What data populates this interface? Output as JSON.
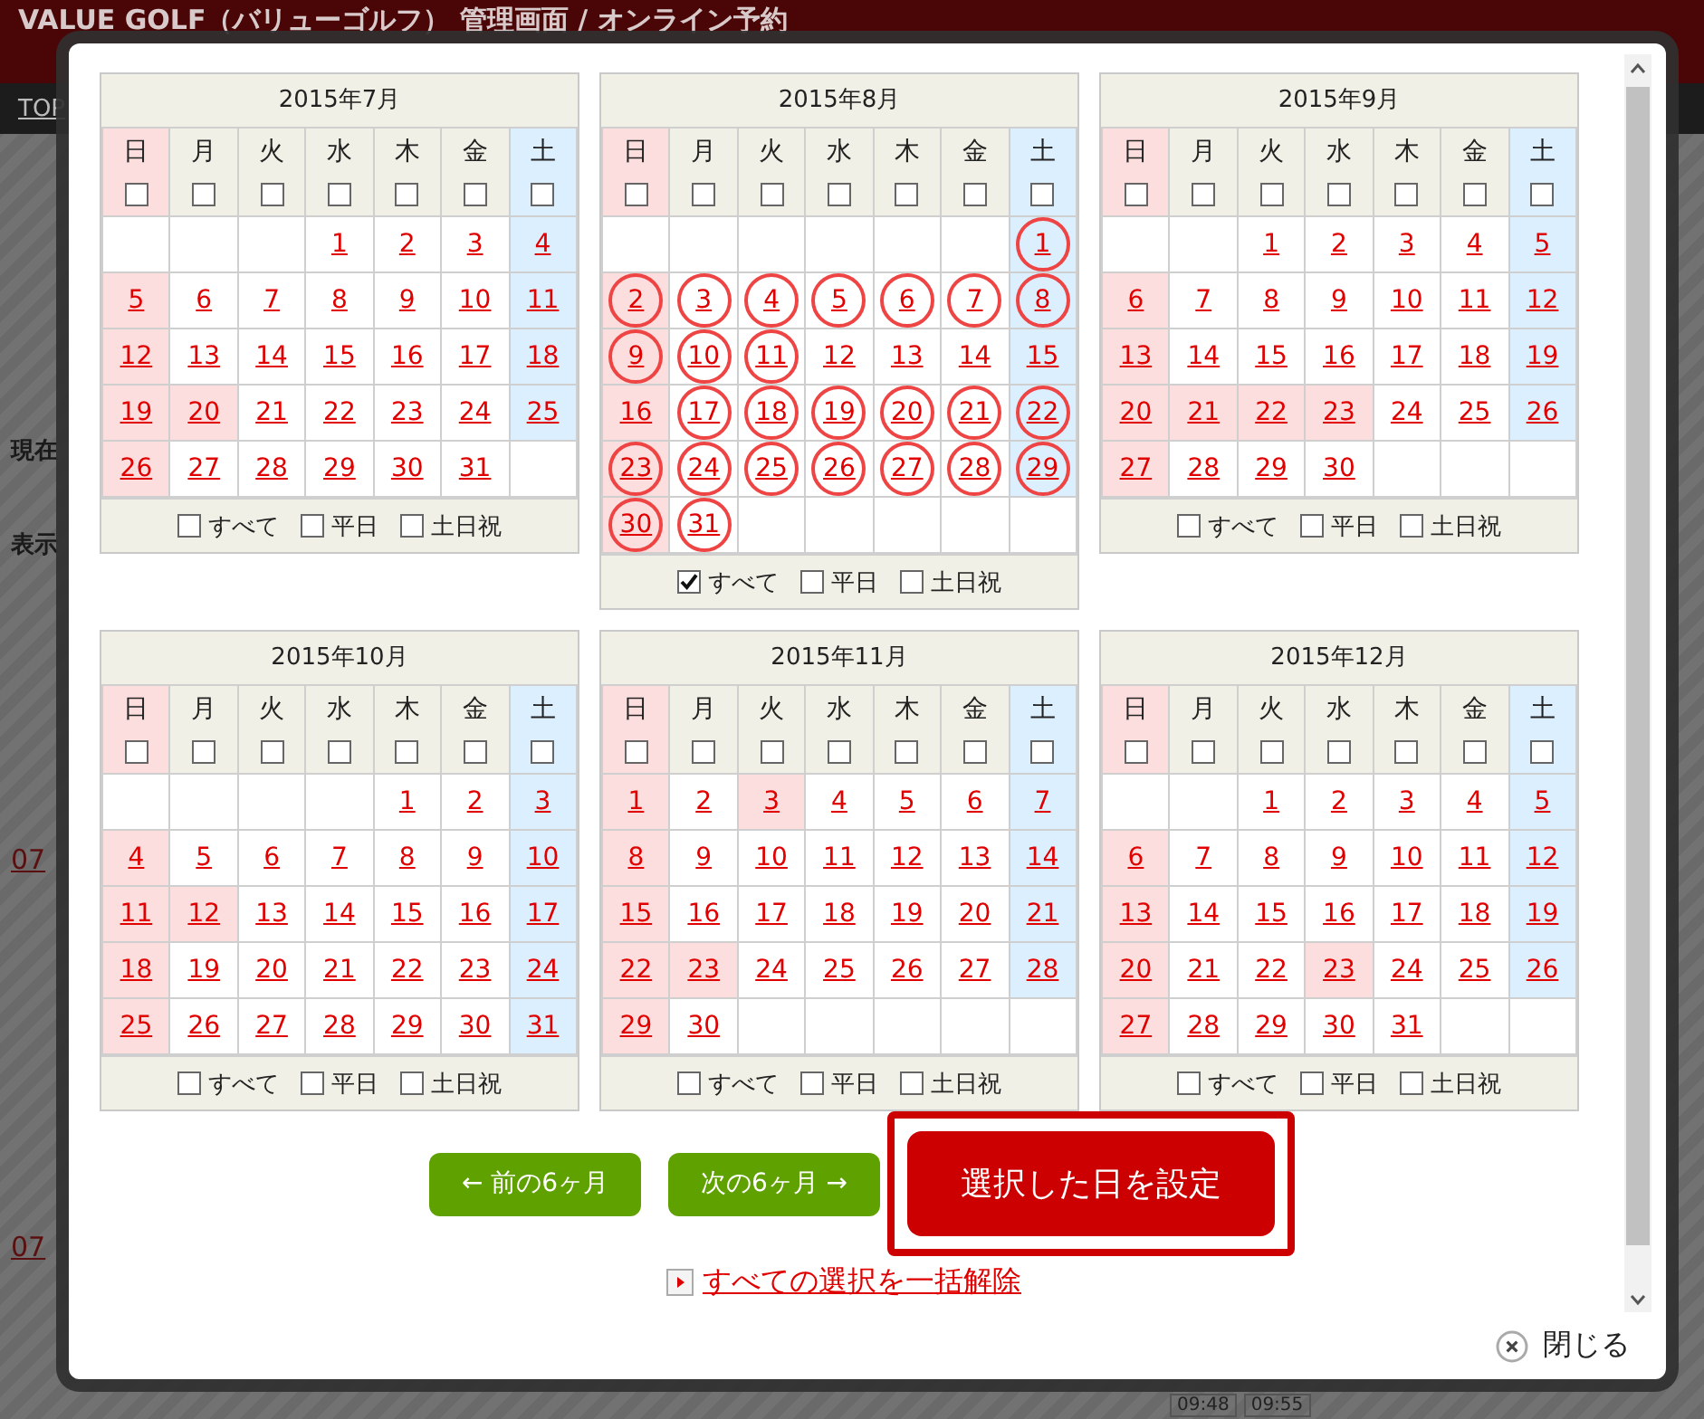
{
  "background": {
    "title": "VALUE GOLF（バリューゴルフ） 管理画面 / オンライン予約",
    "nav_link": "TOP",
    "left_labels": [
      "現在",
      "表示"
    ],
    "row_links": [
      "07",
      "07"
    ],
    "time_chips": [
      "09:48",
      "09:55"
    ]
  },
  "months": [
    {
      "title": "2015年7月",
      "weekdays": [
        {
          "label": "日",
          "checked": false
        },
        {
          "label": "月",
          "checked": false
        },
        {
          "label": "火",
          "checked": false
        },
        {
          "label": "水",
          "checked": false
        },
        {
          "label": "木",
          "checked": false
        },
        {
          "label": "金",
          "checked": false
        },
        {
          "label": "土",
          "checked": false
        }
      ],
      "weeks": [
        [
          {
            "kind": "blank"
          },
          {
            "kind": "blank"
          },
          {
            "kind": "blank"
          },
          {
            "day": "1",
            "kind": "weekday",
            "selected": false
          },
          {
            "day": "2",
            "kind": "weekday",
            "selected": false
          },
          {
            "day": "3",
            "kind": "weekday",
            "selected": false
          },
          {
            "day": "4",
            "kind": "sat",
            "selected": false
          }
        ],
        [
          {
            "day": "5",
            "kind": "sun",
            "selected": false
          },
          {
            "day": "6",
            "kind": "weekday",
            "selected": false
          },
          {
            "day": "7",
            "kind": "weekday",
            "selected": false
          },
          {
            "day": "8",
            "kind": "weekday",
            "selected": false
          },
          {
            "day": "9",
            "kind": "weekday",
            "selected": false
          },
          {
            "day": "10",
            "kind": "weekday",
            "selected": false
          },
          {
            "day": "11",
            "kind": "sat",
            "selected": false
          }
        ],
        [
          {
            "day": "12",
            "kind": "sun",
            "selected": false
          },
          {
            "day": "13",
            "kind": "weekday",
            "selected": false
          },
          {
            "day": "14",
            "kind": "weekday",
            "selected": false
          },
          {
            "day": "15",
            "kind": "weekday",
            "selected": false
          },
          {
            "day": "16",
            "kind": "weekday",
            "selected": false
          },
          {
            "day": "17",
            "kind": "weekday",
            "selected": false
          },
          {
            "day": "18",
            "kind": "sat",
            "selected": false
          }
        ],
        [
          {
            "day": "19",
            "kind": "sun",
            "selected": false
          },
          {
            "day": "20",
            "kind": "holiday",
            "selected": false
          },
          {
            "day": "21",
            "kind": "weekday",
            "selected": false
          },
          {
            "day": "22",
            "kind": "weekday",
            "selected": false
          },
          {
            "day": "23",
            "kind": "weekday",
            "selected": false
          },
          {
            "day": "24",
            "kind": "weekday",
            "selected": false
          },
          {
            "day": "25",
            "kind": "sat",
            "selected": false
          }
        ],
        [
          {
            "day": "26",
            "kind": "sun",
            "selected": false
          },
          {
            "day": "27",
            "kind": "weekday",
            "selected": false
          },
          {
            "day": "28",
            "kind": "weekday",
            "selected": false
          },
          {
            "day": "29",
            "kind": "weekday",
            "selected": false
          },
          {
            "day": "30",
            "kind": "weekday",
            "selected": false
          },
          {
            "day": "31",
            "kind": "weekday",
            "selected": false
          },
          {
            "kind": "blank"
          }
        ]
      ],
      "options": [
        {
          "label": "すべて",
          "checked": false
        },
        {
          "label": "平日",
          "checked": false
        },
        {
          "label": "土日祝",
          "checked": false
        }
      ]
    },
    {
      "title": "2015年8月",
      "weekdays": [
        {
          "label": "日",
          "checked": false
        },
        {
          "label": "月",
          "checked": false
        },
        {
          "label": "火",
          "checked": false
        },
        {
          "label": "水",
          "checked": false
        },
        {
          "label": "木",
          "checked": false
        },
        {
          "label": "金",
          "checked": false
        },
        {
          "label": "土",
          "checked": false
        }
      ],
      "weeks": [
        [
          {
            "kind": "blank"
          },
          {
            "kind": "blank"
          },
          {
            "kind": "blank"
          },
          {
            "kind": "blank"
          },
          {
            "kind": "blank"
          },
          {
            "kind": "blank"
          },
          {
            "day": "1",
            "kind": "sat",
            "selected": true
          }
        ],
        [
          {
            "day": "2",
            "kind": "sun",
            "selected": true
          },
          {
            "day": "3",
            "kind": "weekday",
            "selected": true
          },
          {
            "day": "4",
            "kind": "weekday",
            "selected": true
          },
          {
            "day": "5",
            "kind": "weekday",
            "selected": true
          },
          {
            "day": "6",
            "kind": "weekday",
            "selected": true
          },
          {
            "day": "7",
            "kind": "weekday",
            "selected": true
          },
          {
            "day": "8",
            "kind": "sat",
            "selected": true
          }
        ],
        [
          {
            "day": "9",
            "kind": "sun",
            "selected": true
          },
          {
            "day": "10",
            "kind": "weekday",
            "selected": true
          },
          {
            "day": "11",
            "kind": "weekday",
            "selected": true
          },
          {
            "day": "12",
            "kind": "weekday",
            "selected": false
          },
          {
            "day": "13",
            "kind": "weekday",
            "selected": false
          },
          {
            "day": "14",
            "kind": "weekday",
            "selected": false
          },
          {
            "day": "15",
            "kind": "sat",
            "selected": false
          }
        ],
        [
          {
            "day": "16",
            "kind": "sun",
            "selected": false
          },
          {
            "day": "17",
            "kind": "weekday",
            "selected": true
          },
          {
            "day": "18",
            "kind": "weekday",
            "selected": true
          },
          {
            "day": "19",
            "kind": "weekday",
            "selected": true
          },
          {
            "day": "20",
            "kind": "weekday",
            "selected": true
          },
          {
            "day": "21",
            "kind": "weekday",
            "selected": true
          },
          {
            "day": "22",
            "kind": "sat",
            "selected": true
          }
        ],
        [
          {
            "day": "23",
            "kind": "sun",
            "selected": true
          },
          {
            "day": "24",
            "kind": "weekday",
            "selected": true
          },
          {
            "day": "25",
            "kind": "weekday",
            "selected": true
          },
          {
            "day": "26",
            "kind": "weekday",
            "selected": true
          },
          {
            "day": "27",
            "kind": "weekday",
            "selected": true
          },
          {
            "day": "28",
            "kind": "weekday",
            "selected": true
          },
          {
            "day": "29",
            "kind": "sat",
            "selected": true
          }
        ],
        [
          {
            "day": "30",
            "kind": "sun",
            "selected": true
          },
          {
            "day": "31",
            "kind": "weekday",
            "selected": true
          },
          {
            "kind": "blank"
          },
          {
            "kind": "blank"
          },
          {
            "kind": "blank"
          },
          {
            "kind": "blank"
          },
          {
            "kind": "blank"
          }
        ]
      ],
      "options": [
        {
          "label": "すべて",
          "checked": true
        },
        {
          "label": "平日",
          "checked": false
        },
        {
          "label": "土日祝",
          "checked": false
        }
      ]
    },
    {
      "title": "2015年9月",
      "weekdays": [
        {
          "label": "日",
          "checked": false
        },
        {
          "label": "月",
          "checked": false
        },
        {
          "label": "火",
          "checked": false
        },
        {
          "label": "水",
          "checked": false
        },
        {
          "label": "木",
          "checked": false
        },
        {
          "label": "金",
          "checked": false
        },
        {
          "label": "土",
          "checked": false
        }
      ],
      "weeks": [
        [
          {
            "kind": "blank"
          },
          {
            "kind": "blank"
          },
          {
            "day": "1",
            "kind": "weekday",
            "selected": false
          },
          {
            "day": "2",
            "kind": "weekday",
            "selected": false
          },
          {
            "day": "3",
            "kind": "weekday",
            "selected": false
          },
          {
            "day": "4",
            "kind": "weekday",
            "selected": false
          },
          {
            "day": "5",
            "kind": "sat",
            "selected": false
          }
        ],
        [
          {
            "day": "6",
            "kind": "sun",
            "selected": false
          },
          {
            "day": "7",
            "kind": "weekday",
            "selected": false
          },
          {
            "day": "8",
            "kind": "weekday",
            "selected": false
          },
          {
            "day": "9",
            "kind": "weekday",
            "selected": false
          },
          {
            "day": "10",
            "kind": "weekday",
            "selected": false
          },
          {
            "day": "11",
            "kind": "weekday",
            "selected": false
          },
          {
            "day": "12",
            "kind": "sat",
            "selected": false
          }
        ],
        [
          {
            "day": "13",
            "kind": "sun",
            "selected": false
          },
          {
            "day": "14",
            "kind": "weekday",
            "selected": false
          },
          {
            "day": "15",
            "kind": "weekday",
            "selected": false
          },
          {
            "day": "16",
            "kind": "weekday",
            "selected": false
          },
          {
            "day": "17",
            "kind": "weekday",
            "selected": false
          },
          {
            "day": "18",
            "kind": "weekday",
            "selected": false
          },
          {
            "day": "19",
            "kind": "sat",
            "selected": false
          }
        ],
        [
          {
            "day": "20",
            "kind": "sun",
            "selected": false
          },
          {
            "day": "21",
            "kind": "holiday",
            "selected": false
          },
          {
            "day": "22",
            "kind": "holiday",
            "selected": false
          },
          {
            "day": "23",
            "kind": "holiday",
            "selected": false
          },
          {
            "day": "24",
            "kind": "weekday",
            "selected": false
          },
          {
            "day": "25",
            "kind": "weekday",
            "selected": false
          },
          {
            "day": "26",
            "kind": "sat",
            "selected": false
          }
        ],
        [
          {
            "day": "27",
            "kind": "sun",
            "selected": false
          },
          {
            "day": "28",
            "kind": "weekday",
            "selected": false
          },
          {
            "day": "29",
            "kind": "weekday",
            "selected": false
          },
          {
            "day": "30",
            "kind": "weekday",
            "selected": false
          },
          {
            "kind": "blank"
          },
          {
            "kind": "blank"
          },
          {
            "kind": "blank"
          }
        ]
      ],
      "options": [
        {
          "label": "すべて",
          "checked": false
        },
        {
          "label": "平日",
          "checked": false
        },
        {
          "label": "土日祝",
          "checked": false
        }
      ]
    },
    {
      "title": "2015年10月",
      "weekdays": [
        {
          "label": "日",
          "checked": false
        },
        {
          "label": "月",
          "checked": false
        },
        {
          "label": "火",
          "checked": false
        },
        {
          "label": "水",
          "checked": false
        },
        {
          "label": "木",
          "checked": false
        },
        {
          "label": "金",
          "checked": false
        },
        {
          "label": "土",
          "checked": false
        }
      ],
      "weeks": [
        [
          {
            "kind": "blank"
          },
          {
            "kind": "blank"
          },
          {
            "kind": "blank"
          },
          {
            "kind": "blank"
          },
          {
            "day": "1",
            "kind": "weekday",
            "selected": false
          },
          {
            "day": "2",
            "kind": "weekday",
            "selected": false
          },
          {
            "day": "3",
            "kind": "sat",
            "selected": false
          }
        ],
        [
          {
            "day": "4",
            "kind": "sun",
            "selected": false
          },
          {
            "day": "5",
            "kind": "weekday",
            "selected": false
          },
          {
            "day": "6",
            "kind": "weekday",
            "selected": false
          },
          {
            "day": "7",
            "kind": "weekday",
            "selected": false
          },
          {
            "day": "8",
            "kind": "weekday",
            "selected": false
          },
          {
            "day": "9",
            "kind": "weekday",
            "selected": false
          },
          {
            "day": "10",
            "kind": "sat",
            "selected": false
          }
        ],
        [
          {
            "day": "11",
            "kind": "sun",
            "selected": false
          },
          {
            "day": "12",
            "kind": "holiday",
            "selected": false
          },
          {
            "day": "13",
            "kind": "weekday",
            "selected": false
          },
          {
            "day": "14",
            "kind": "weekday",
            "selected": false
          },
          {
            "day": "15",
            "kind": "weekday",
            "selected": false
          },
          {
            "day": "16",
            "kind": "weekday",
            "selected": false
          },
          {
            "day": "17",
            "kind": "sat",
            "selected": false
          }
        ],
        [
          {
            "day": "18",
            "kind": "sun",
            "selected": false
          },
          {
            "day": "19",
            "kind": "weekday",
            "selected": false
          },
          {
            "day": "20",
            "kind": "weekday",
            "selected": false
          },
          {
            "day": "21",
            "kind": "weekday",
            "selected": false
          },
          {
            "day": "22",
            "kind": "weekday",
            "selected": false
          },
          {
            "day": "23",
            "kind": "weekday",
            "selected": false
          },
          {
            "day": "24",
            "kind": "sat",
            "selected": false
          }
        ],
        [
          {
            "day": "25",
            "kind": "sun",
            "selected": false
          },
          {
            "day": "26",
            "kind": "weekday",
            "selected": false
          },
          {
            "day": "27",
            "kind": "weekday",
            "selected": false
          },
          {
            "day": "28",
            "kind": "weekday",
            "selected": false
          },
          {
            "day": "29",
            "kind": "weekday",
            "selected": false
          },
          {
            "day": "30",
            "kind": "weekday",
            "selected": false
          },
          {
            "day": "31",
            "kind": "sat",
            "selected": false
          }
        ]
      ],
      "options": [
        {
          "label": "すべて",
          "checked": false
        },
        {
          "label": "平日",
          "checked": false
        },
        {
          "label": "土日祝",
          "checked": false
        }
      ]
    },
    {
      "title": "2015年11月",
      "weekdays": [
        {
          "label": "日",
          "checked": false
        },
        {
          "label": "月",
          "checked": false
        },
        {
          "label": "火",
          "checked": false
        },
        {
          "label": "水",
          "checked": false
        },
        {
          "label": "木",
          "checked": false
        },
        {
          "label": "金",
          "checked": false
        },
        {
          "label": "土",
          "checked": false
        }
      ],
      "weeks": [
        [
          {
            "day": "1",
            "kind": "sun",
            "selected": false
          },
          {
            "day": "2",
            "kind": "weekday",
            "selected": false
          },
          {
            "day": "3",
            "kind": "holiday",
            "selected": false
          },
          {
            "day": "4",
            "kind": "weekday",
            "selected": false
          },
          {
            "day": "5",
            "kind": "weekday",
            "selected": false
          },
          {
            "day": "6",
            "kind": "weekday",
            "selected": false
          },
          {
            "day": "7",
            "kind": "sat",
            "selected": false
          }
        ],
        [
          {
            "day": "8",
            "kind": "sun",
            "selected": false
          },
          {
            "day": "9",
            "kind": "weekday",
            "selected": false
          },
          {
            "day": "10",
            "kind": "weekday",
            "selected": false
          },
          {
            "day": "11",
            "kind": "weekday",
            "selected": false
          },
          {
            "day": "12",
            "kind": "weekday",
            "selected": false
          },
          {
            "day": "13",
            "kind": "weekday",
            "selected": false
          },
          {
            "day": "14",
            "kind": "sat",
            "selected": false
          }
        ],
        [
          {
            "day": "15",
            "kind": "sun",
            "selected": false
          },
          {
            "day": "16",
            "kind": "weekday",
            "selected": false
          },
          {
            "day": "17",
            "kind": "weekday",
            "selected": false
          },
          {
            "day": "18",
            "kind": "weekday",
            "selected": false
          },
          {
            "day": "19",
            "kind": "weekday",
            "selected": false
          },
          {
            "day": "20",
            "kind": "weekday",
            "selected": false
          },
          {
            "day": "21",
            "kind": "sat",
            "selected": false
          }
        ],
        [
          {
            "day": "22",
            "kind": "sun",
            "selected": false
          },
          {
            "day": "23",
            "kind": "holiday",
            "selected": false
          },
          {
            "day": "24",
            "kind": "weekday",
            "selected": false
          },
          {
            "day": "25",
            "kind": "weekday",
            "selected": false
          },
          {
            "day": "26",
            "kind": "weekday",
            "selected": false
          },
          {
            "day": "27",
            "kind": "weekday",
            "selected": false
          },
          {
            "day": "28",
            "kind": "sat",
            "selected": false
          }
        ],
        [
          {
            "day": "29",
            "kind": "sun",
            "selected": false
          },
          {
            "day": "30",
            "kind": "weekday",
            "selected": false
          },
          {
            "kind": "blank"
          },
          {
            "kind": "blank"
          },
          {
            "kind": "blank"
          },
          {
            "kind": "blank"
          },
          {
            "kind": "blank"
          }
        ]
      ],
      "options": [
        {
          "label": "すべて",
          "checked": false
        },
        {
          "label": "平日",
          "checked": false
        },
        {
          "label": "土日祝",
          "checked": false
        }
      ]
    },
    {
      "title": "2015年12月",
      "weekdays": [
        {
          "label": "日",
          "checked": false
        },
        {
          "label": "月",
          "checked": false
        },
        {
          "label": "火",
          "checked": false
        },
        {
          "label": "水",
          "checked": false
        },
        {
          "label": "木",
          "checked": false
        },
        {
          "label": "金",
          "checked": false
        },
        {
          "label": "土",
          "checked": false
        }
      ],
      "weeks": [
        [
          {
            "kind": "blank"
          },
          {
            "kind": "blank"
          },
          {
            "day": "1",
            "kind": "weekday",
            "selected": false
          },
          {
            "day": "2",
            "kind": "weekday",
            "selected": false
          },
          {
            "day": "3",
            "kind": "weekday",
            "selected": false
          },
          {
            "day": "4",
            "kind": "weekday",
            "selected": false
          },
          {
            "day": "5",
            "kind": "sat",
            "selected": false
          }
        ],
        [
          {
            "day": "6",
            "kind": "sun",
            "selected": false
          },
          {
            "day": "7",
            "kind": "weekday",
            "selected": false
          },
          {
            "day": "8",
            "kind": "weekday",
            "selected": false
          },
          {
            "day": "9",
            "kind": "weekday",
            "selected": false
          },
          {
            "day": "10",
            "kind": "weekday",
            "selected": false
          },
          {
            "day": "11",
            "kind": "weekday",
            "selected": false
          },
          {
            "day": "12",
            "kind": "sat",
            "selected": false
          }
        ],
        [
          {
            "day": "13",
            "kind": "sun",
            "selected": false
          },
          {
            "day": "14",
            "kind": "weekday",
            "selected": false
          },
          {
            "day": "15",
            "kind": "weekday",
            "selected": false
          },
          {
            "day": "16",
            "kind": "weekday",
            "selected": false
          },
          {
            "day": "17",
            "kind": "weekday",
            "selected": false
          },
          {
            "day": "18",
            "kind": "weekday",
            "selected": false
          },
          {
            "day": "19",
            "kind": "sat",
            "selected": false
          }
        ],
        [
          {
            "day": "20",
            "kind": "sun",
            "selected": false
          },
          {
            "day": "21",
            "kind": "weekday",
            "selected": false
          },
          {
            "day": "22",
            "kind": "weekday",
            "selected": false
          },
          {
            "day": "23",
            "kind": "holiday",
            "selected": false
          },
          {
            "day": "24",
            "kind": "weekday",
            "selected": false
          },
          {
            "day": "25",
            "kind": "weekday",
            "selected": false
          },
          {
            "day": "26",
            "kind": "sat",
            "selected": false
          }
        ],
        [
          {
            "day": "27",
            "kind": "sun",
            "selected": false
          },
          {
            "day": "28",
            "kind": "weekday",
            "selected": false
          },
          {
            "day": "29",
            "kind": "weekday",
            "selected": false
          },
          {
            "day": "30",
            "kind": "weekday",
            "selected": false
          },
          {
            "day": "31",
            "kind": "weekday",
            "selected": false
          },
          {
            "kind": "blank"
          },
          {
            "kind": "blank"
          }
        ]
      ],
      "options": [
        {
          "label": "すべて",
          "checked": false
        },
        {
          "label": "平日",
          "checked": false
        },
        {
          "label": "土日祝",
          "checked": false
        }
      ]
    }
  ],
  "buttons": {
    "previous": "← 前の6ヶ月",
    "next": "次の6ヶ月 →",
    "apply": "選択した日を設定"
  },
  "clear_link": "すべての選択を一括解除",
  "close": "閉じる"
}
